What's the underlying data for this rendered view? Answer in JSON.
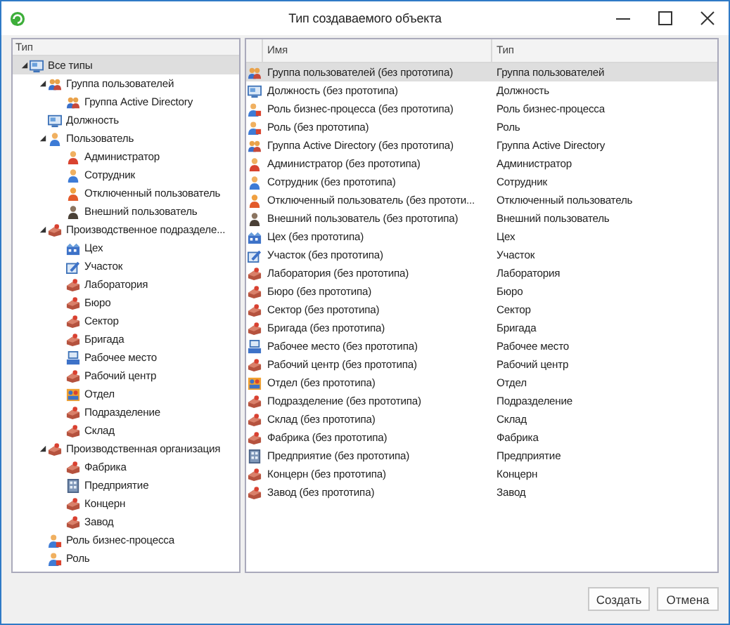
{
  "window": {
    "title": "Тип создаваемого объекта"
  },
  "tree": {
    "header": "Тип",
    "items": [
      {
        "label": "Все типы",
        "kind": "position",
        "selected": true,
        "expanded": true,
        "children": [
          {
            "label": "Группа пользователей",
            "kind": "group",
            "selected": false,
            "expanded": true,
            "children": [
              {
                "label": "Группа Active Directory",
                "kind": "group",
                "selected": false
              }
            ]
          },
          {
            "label": "Должность",
            "kind": "position",
            "selected": false
          },
          {
            "label": "Пользователь",
            "kind": "user",
            "selected": false,
            "expanded": true,
            "children": [
              {
                "label": "Администратор",
                "kind": "admin",
                "selected": false
              },
              {
                "label": "Сотрудник",
                "kind": "user",
                "selected": false
              },
              {
                "label": "Отключенный пользователь",
                "kind": "disabled",
                "selected": false
              },
              {
                "label": "Внешний пользователь",
                "kind": "external",
                "selected": false
              }
            ]
          },
          {
            "label": "Производственное подразделе...",
            "kind": "brick",
            "selected": false,
            "expanded": true,
            "children": [
              {
                "label": "Цех",
                "kind": "workshop",
                "selected": false
              },
              {
                "label": "Участок",
                "kind": "site",
                "selected": false
              },
              {
                "label": "Лаборатория",
                "kind": "brick",
                "selected": false
              },
              {
                "label": "Бюро",
                "kind": "brick",
                "selected": false
              },
              {
                "label": "Сектор",
                "kind": "brick",
                "selected": false
              },
              {
                "label": "Бригада",
                "kind": "brick",
                "selected": false
              },
              {
                "label": "Рабочее место",
                "kind": "workplace",
                "selected": false
              },
              {
                "label": "Рабочий центр",
                "kind": "brick",
                "selected": false
              },
              {
                "label": "Отдел",
                "kind": "department",
                "selected": false
              },
              {
                "label": "Подразделение",
                "kind": "brick",
                "selected": false
              },
              {
                "label": "Склад",
                "kind": "brick",
                "selected": false
              }
            ]
          },
          {
            "label": "Производственная организация",
            "kind": "brick",
            "selected": false,
            "expanded": true,
            "children": [
              {
                "label": "Фабрика",
                "kind": "brick",
                "selected": false
              },
              {
                "label": "Предприятие",
                "kind": "enterprise",
                "selected": false
              },
              {
                "label": "Концерн",
                "kind": "brick",
                "selected": false
              },
              {
                "label": "Завод",
                "kind": "brick",
                "selected": false
              }
            ]
          },
          {
            "label": "Роль бизнес-процесса",
            "kind": "role",
            "selected": false
          },
          {
            "label": "Роль",
            "kind": "role",
            "selected": false
          }
        ]
      }
    ]
  },
  "table": {
    "columns": [
      "Имя",
      "Тип"
    ],
    "rows": [
      {
        "kind": "group",
        "name": "Группа пользователей (без прототипа)",
        "type": "Группа пользователей",
        "selected": true
      },
      {
        "kind": "position",
        "name": "Должность (без прототипа)",
        "type": "Должность",
        "selected": false
      },
      {
        "kind": "role",
        "name": "Роль бизнес-процесса (без прототипа)",
        "type": "Роль бизнес-процесса",
        "selected": false
      },
      {
        "kind": "role",
        "name": "Роль (без прототипа)",
        "type": "Роль",
        "selected": false
      },
      {
        "kind": "group",
        "name": "Группа Active Directory (без прототипа)",
        "type": "Группа Active Directory",
        "selected": false
      },
      {
        "kind": "admin",
        "name": "Администратор (без прототипа)",
        "type": "Администратор",
        "selected": false
      },
      {
        "kind": "user",
        "name": "Сотрудник (без прототипа)",
        "type": "Сотрудник",
        "selected": false
      },
      {
        "kind": "disabled",
        "name": "Отключенный пользователь (без прототи...",
        "type": "Отключенный пользователь",
        "selected": false
      },
      {
        "kind": "external",
        "name": "Внешний пользователь (без прототипа)",
        "type": "Внешний пользователь",
        "selected": false
      },
      {
        "kind": "workshop",
        "name": "Цех (без прототипа)",
        "type": "Цех",
        "selected": false
      },
      {
        "kind": "site",
        "name": "Участок (без прототипа)",
        "type": "Участок",
        "selected": false
      },
      {
        "kind": "brick",
        "name": "Лаборатория (без прототипа)",
        "type": "Лаборатория",
        "selected": false
      },
      {
        "kind": "brick",
        "name": "Бюро (без прототипа)",
        "type": "Бюро",
        "selected": false
      },
      {
        "kind": "brick",
        "name": "Сектор (без прототипа)",
        "type": "Сектор",
        "selected": false
      },
      {
        "kind": "brick",
        "name": "Бригада (без прототипа)",
        "type": "Бригада",
        "selected": false
      },
      {
        "kind": "workplace",
        "name": "Рабочее место (без прототипа)",
        "type": "Рабочее место",
        "selected": false
      },
      {
        "kind": "brick",
        "name": "Рабочий центр (без прототипа)",
        "type": "Рабочий центр",
        "selected": false
      },
      {
        "kind": "department",
        "name": "Отдел (без прототипа)",
        "type": "Отдел",
        "selected": false
      },
      {
        "kind": "brick",
        "name": "Подразделение (без прототипа)",
        "type": "Подразделение",
        "selected": false
      },
      {
        "kind": "brick",
        "name": "Склад (без прототипа)",
        "type": "Склад",
        "selected": false
      },
      {
        "kind": "brick",
        "name": "Фабрика (без прототипа)",
        "type": "Фабрика",
        "selected": false
      },
      {
        "kind": "enterprise",
        "name": "Предприятие (без прототипа)",
        "type": "Предприятие",
        "selected": false
      },
      {
        "kind": "brick",
        "name": "Концерн (без прототипа)",
        "type": "Концерн",
        "selected": false
      },
      {
        "kind": "brick",
        "name": "Завод (без прототипа)",
        "type": "Завод",
        "selected": false
      }
    ]
  },
  "buttons": [
    "Создать",
    "Отмена"
  ]
}
